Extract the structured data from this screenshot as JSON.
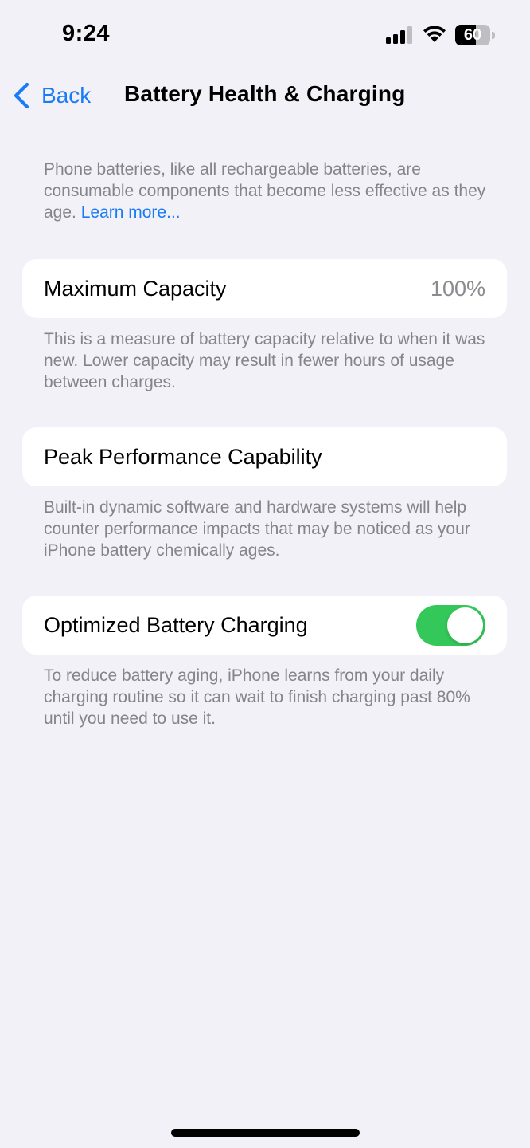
{
  "status_bar": {
    "time": "9:24",
    "battery_level": "60",
    "signal_icon": "cellular-signal-icon",
    "wifi_icon": "wifi-icon",
    "battery_icon": "battery-icon"
  },
  "nav": {
    "back_label": "Back",
    "back_icon": "chevron-left-icon",
    "title": "Battery Health & Charging"
  },
  "intro": {
    "text": "Phone batteries, like all rechargeable batteries, are consumable components that become less effective as they age. ",
    "link": "Learn more..."
  },
  "maximum_capacity": {
    "label": "Maximum Capacity",
    "value": "100%",
    "footer": "This is a measure of battery capacity relative to when it was new. Lower capacity may result in fewer hours of usage between charges."
  },
  "peak_performance": {
    "label": "Peak Performance Capability",
    "footer": "Built-in dynamic software and hardware systems will help counter performance impacts that may be noticed as your iPhone battery chemically ages."
  },
  "optimized_charging": {
    "label": "Optimized Battery Charging",
    "enabled": true,
    "footer": "To reduce battery aging, iPhone learns from your daily charging routine so it can wait to finish charging past 80% until you need to use it."
  },
  "colors": {
    "background": "#f2f1f7",
    "accent": "#1a7cf5",
    "toggle_on": "#34c759",
    "secondary_text": "#85848a"
  }
}
